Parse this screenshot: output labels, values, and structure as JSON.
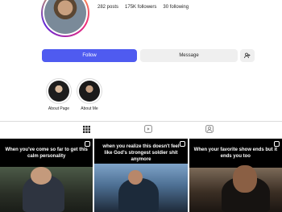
{
  "profile": {
    "stats": {
      "posts": "282 posts",
      "followers": "175K followers",
      "following": "30 following"
    }
  },
  "actions": {
    "follow_label": "Follow",
    "message_label": "Message"
  },
  "highlights": [
    {
      "label": "About Page"
    },
    {
      "label": "About Me"
    }
  ],
  "tabs": [
    {
      "icon": "grid-icon"
    },
    {
      "icon": "reels-icon"
    },
    {
      "icon": "tagged-icon"
    }
  ],
  "posts": [
    {
      "caption": "When you've come so far to get this calm personality"
    },
    {
      "caption": "when you realize this doesn't feel like God's strongest soldier shit anymore"
    },
    {
      "caption": "When your favorite show ends but it ends you too"
    }
  ],
  "colors": {
    "follow_button": "#4f5bf0",
    "secondary_button": "#efefef"
  }
}
